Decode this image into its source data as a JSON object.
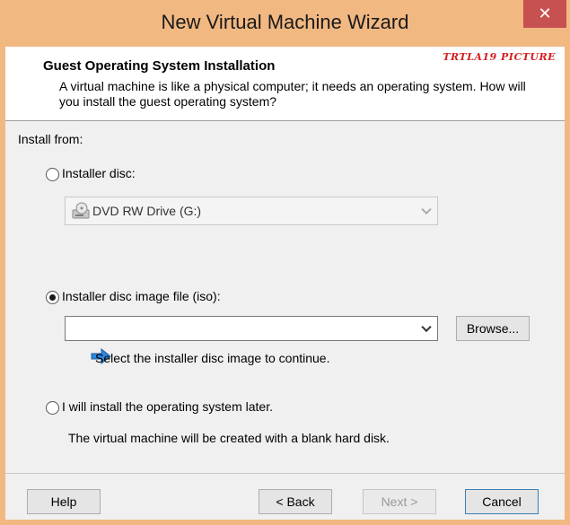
{
  "window": {
    "title": "New Virtual Machine Wizard",
    "close_glyph": "✕"
  },
  "header": {
    "title": "Guest Operating System Installation",
    "description": "A virtual machine is like a physical computer; it needs an operating system. How will you install the guest operating system?",
    "watermark": "TRTLA19 PICTURE"
  },
  "install_from": {
    "label": "Install from:",
    "options": {
      "installer_disc": {
        "label": "Installer disc:",
        "selected": false
      },
      "iso": {
        "label": "Installer disc image file (iso):",
        "selected": true
      },
      "later": {
        "label": "I will install the operating system later.",
        "selected": false
      }
    },
    "disc_drive": {
      "value": "DVD RW Drive (G:)",
      "icon": "dvd-drive-icon",
      "enabled": false
    },
    "iso_path": {
      "value": "",
      "icon": "chevron-down-icon"
    },
    "browse_label": "Browse...",
    "iso_hint": "Select the installer disc image to continue.",
    "later_hint": "The virtual machine will be created with a blank hard disk."
  },
  "footer": {
    "help": "Help",
    "back": "< Back",
    "next": "Next >",
    "cancel": "Cancel"
  },
  "colors": {
    "title_bar": "#f1b882",
    "close": "#c75050",
    "info_arrow": "#2e86de",
    "watermark": "#d32020"
  }
}
